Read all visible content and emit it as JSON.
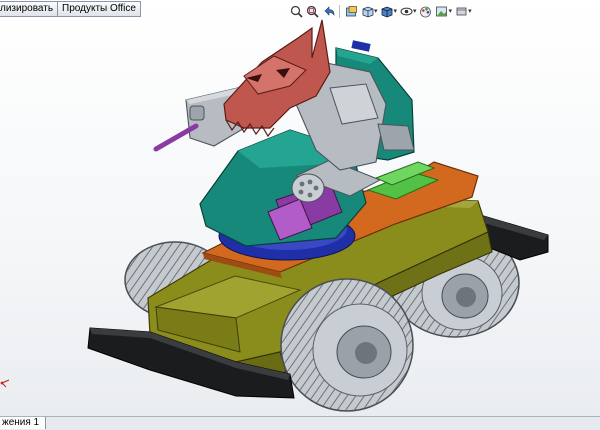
{
  "tabs": [
    {
      "label": "лизировать"
    },
    {
      "label": "Продукты Office"
    }
  ],
  "heads_up_toolbar": [
    {
      "icon": "zoom-to-fit-icon"
    },
    {
      "icon": "zoom-to-area-icon"
    },
    {
      "icon": "previous-view-icon"
    },
    {
      "icon": "section-view-icon"
    },
    {
      "icon": "view-orientation-icon"
    },
    {
      "icon": "display-style-icon"
    },
    {
      "icon": "hide-show-items-icon"
    },
    {
      "icon": "edit-appearance-icon"
    },
    {
      "icon": "apply-scene-icon"
    },
    {
      "icon": "view-settings-icon"
    }
  ],
  "bottom_tab": {
    "label": "жения 1"
  },
  "colors": {
    "olive": "#8a8c1c",
    "teal": "#17897a",
    "orange": "#d2691e",
    "red": "#c0574e",
    "gray": "#b7bcc3",
    "purple": "#8a3aa3",
    "green": "#53c046",
    "blue": "#1f2fa8"
  }
}
